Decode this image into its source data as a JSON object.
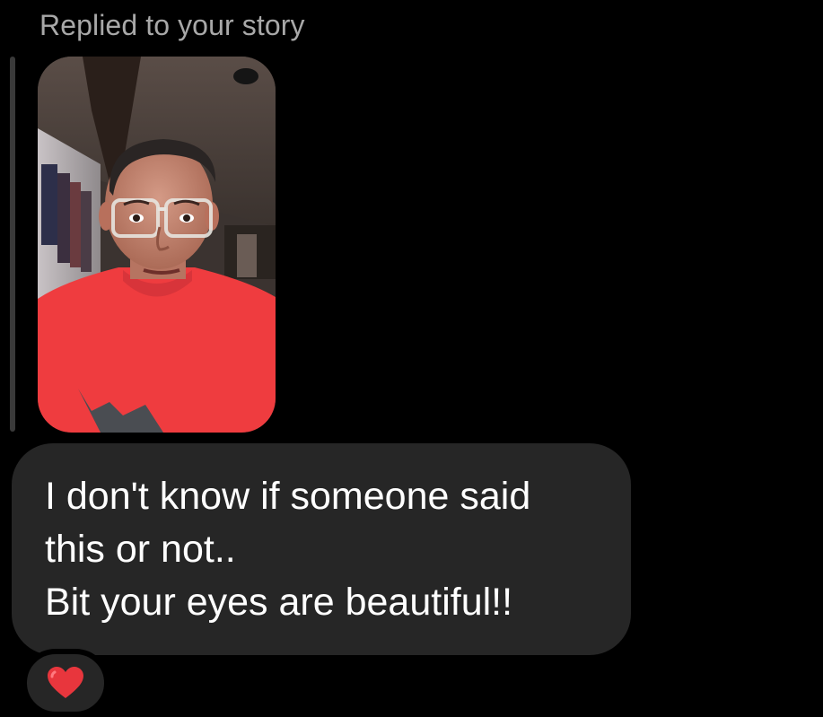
{
  "reply": {
    "label": "Replied to your story"
  },
  "story": {
    "image_alt": "Story photo: selfie of a man wearing clear-framed glasses and a red t-shirt"
  },
  "message": {
    "lines": [
      "I don't know if someone said",
      "this or not..",
      "Bit your eyes are beautiful!!"
    ]
  },
  "reaction": {
    "emoji_icon": "heart-icon",
    "color": "#e8363d"
  },
  "colors": {
    "background": "#000000",
    "bubble": "#262626",
    "label": "#a8a8a8",
    "text": "#ffffff",
    "shirt": "#ef3c3f"
  }
}
